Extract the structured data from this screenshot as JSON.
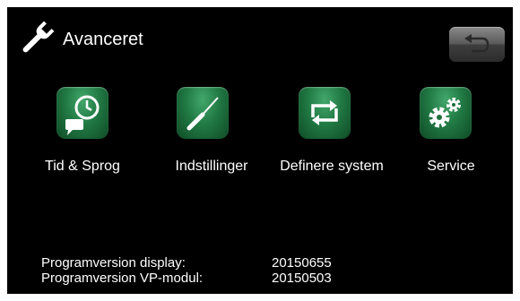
{
  "header": {
    "title": "Avanceret",
    "title_icon": "wrench-icon",
    "back_icon": "back-arrow-icon"
  },
  "menu": {
    "items": [
      {
        "label": "Tid & Sprog",
        "icon": "clock-speech-bubble-icon"
      },
      {
        "label": "Indstillinger",
        "icon": "screwdriver-icon"
      },
      {
        "label": "Definere system",
        "icon": "cycle-arrows-icon"
      },
      {
        "label": "Service",
        "icon": "gears-icon"
      }
    ]
  },
  "info": {
    "display_label": "Programversion display:",
    "display_value": "20150655",
    "vp_label": "Programversion VP-modul:",
    "vp_value": "20150503"
  },
  "colors": {
    "background": "#000000",
    "tile_green": "#217a44",
    "text": "#ffffff"
  }
}
